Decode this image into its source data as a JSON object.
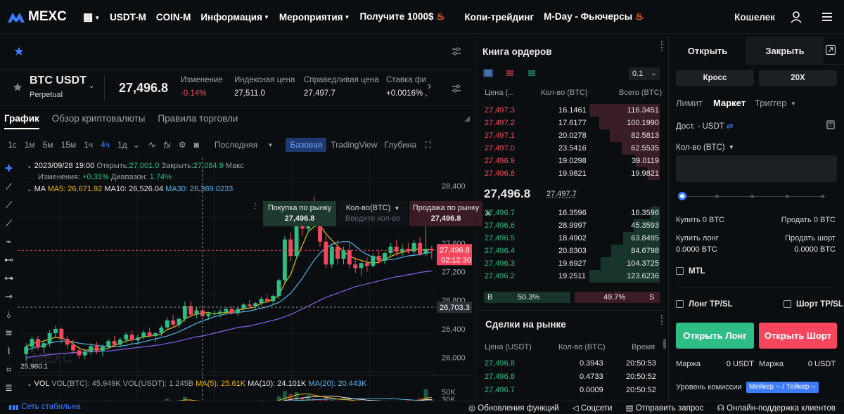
{
  "header": {
    "logo_text": "MEXC",
    "nav": [
      "USDT-M",
      "COIN-M",
      "Информация",
      "Мероприятия",
      "Получите 1000$",
      "Копи-трейдинг",
      "M-Day - Фьючерсы"
    ],
    "wallet": "Кошелек"
  },
  "ticker": {
    "symbol": "BTC USDT",
    "contract": "Perpetual",
    "last_price": "27,496.8",
    "change_label": "Изменение",
    "change_value": "-0.14%",
    "index_label": "Индексная цена",
    "index_value": "27,511.0",
    "fair_label": "Справедливая цена",
    "fair_value": "27,497.7",
    "funding_label": "Ставка фи",
    "funding_value": "+0.0016% ,"
  },
  "tabs": [
    "График",
    "Обзор криптовалюты",
    "Правила торговли"
  ],
  "timeframes": [
    "1с",
    "1м",
    "5м",
    "15м",
    "1ч",
    "4ч",
    "1д"
  ],
  "active_timeframe": "4ч",
  "price_type": "Последняя",
  "views": {
    "basic": "Базовая",
    "tradingview": "TradingView",
    "depth": "Глубина"
  },
  "ohlc": {
    "date": "2023/09/28 19:00",
    "open_label": "Открыть:",
    "open": "27,001.0",
    "close_label": "Закрыть:",
    "close": "27,084.9",
    "max_label": "Макс",
    "change_label": "Изменения:",
    "change": "+0.31%",
    "range_label": "Диапазон:",
    "range": "1.74%"
  },
  "ma": {
    "label": "MA",
    "ma5": "MA5: 26,671.92",
    "ma10": "MA10: 26,526.04",
    "ma30": "MA30: 26,389.0233"
  },
  "vol": {
    "label": "VOL",
    "btc": "VOL(BTC): 45.949K",
    "usdt": "VOL(USDT): 1.245B",
    "ma5": "MA(5): 25.61K",
    "ma10": "MA(10): 24.101K",
    "ma20": "MA(20): 20.443K"
  },
  "quick": {
    "buy_label": "Покупка по рынку",
    "buy_price": "27,496.8",
    "qty_label": "Кол-во(BTC)",
    "qty_placeholder": "Введите кол-во",
    "sell_label": "Продажа по рынку",
    "sell_price": "27,496.8"
  },
  "price_axis": [
    "28,400",
    "28,000",
    "27,600",
    "27,200",
    "26,800",
    "26,400",
    "26,000"
  ],
  "vol_axis": [
    "50K",
    "30K",
    "10K"
  ],
  "marks": {
    "current": "27,496.8",
    "countdown": "02:12:30",
    "crosshair": "26,703.3",
    "low": "25,980.1"
  },
  "chart_data": {
    "type": "candlestick",
    "candles": [
      [
        26050,
        26200,
        25950,
        26150
      ],
      [
        26150,
        26300,
        26080,
        26260
      ],
      [
        26260,
        26300,
        26100,
        26140
      ],
      [
        26140,
        26250,
        26060,
        26200
      ],
      [
        26200,
        26380,
        26150,
        26340
      ],
      [
        26340,
        26450,
        26280,
        26400
      ],
      [
        26400,
        26420,
        26200,
        26260
      ],
      [
        26260,
        26300,
        26120,
        26180
      ],
      [
        26180,
        26250,
        26050,
        26100
      ],
      [
        26100,
        26150,
        25980,
        26030
      ],
      [
        26030,
        26120,
        25980,
        26080
      ],
      [
        26080,
        26200,
        26040,
        26160
      ],
      [
        26160,
        26220,
        26050,
        26090
      ],
      [
        26090,
        26180,
        26020,
        26150
      ],
      [
        26150,
        26260,
        26120,
        26230
      ],
      [
        26230,
        26300,
        26150,
        26180
      ],
      [
        26180,
        26280,
        26140,
        26250
      ],
      [
        26250,
        26350,
        26200,
        26320
      ],
      [
        26320,
        26380,
        26200,
        26240
      ],
      [
        26240,
        26320,
        26180,
        26280
      ],
      [
        26280,
        26380,
        26250,
        26350
      ],
      [
        26350,
        26420,
        26280,
        26300
      ],
      [
        26300,
        26360,
        26220,
        26340
      ],
      [
        26340,
        26450,
        26300,
        26420
      ],
      [
        26420,
        26560,
        26380,
        26520
      ],
      [
        26520,
        26600,
        26420,
        26460
      ],
      [
        26460,
        26560,
        26420,
        26540
      ],
      [
        26540,
        26780,
        26500,
        26720
      ],
      [
        26720,
        26790,
        26560,
        26600
      ],
      [
        26600,
        26700,
        26550,
        26660
      ],
      [
        26660,
        26700,
        26540,
        26580
      ],
      [
        26580,
        26640,
        26520,
        26610
      ],
      [
        26610,
        26660,
        26560,
        26620
      ],
      [
        26620,
        26680,
        26560,
        26640
      ],
      [
        26640,
        26700,
        26600,
        26680
      ],
      [
        26680,
        26720,
        26600,
        26620
      ],
      [
        26620,
        26700,
        26580,
        26680
      ],
      [
        26680,
        26760,
        26650,
        26740
      ],
      [
        26740,
        26800,
        26680,
        26720
      ],
      [
        26720,
        26780,
        26660,
        26760
      ],
      [
        26760,
        26850,
        26720,
        26820
      ],
      [
        26820,
        26880,
        26760,
        26790
      ],
      [
        26790,
        26880,
        26750,
        26860
      ],
      [
        26860,
        27100,
        26820,
        27080
      ],
      [
        27080,
        27700,
        27050,
        27650
      ],
      [
        27650,
        27750,
        27350,
        27420
      ],
      [
        27420,
        28000,
        27380,
        27900
      ],
      [
        27900,
        28050,
        27700,
        27800
      ],
      [
        27800,
        28150,
        27750,
        28050
      ],
      [
        28050,
        28250,
        27850,
        27950
      ],
      [
        27950,
        28000,
        27550,
        27620
      ],
      [
        27620,
        27700,
        27250,
        27300
      ],
      [
        27300,
        27600,
        27250,
        27550
      ],
      [
        27550,
        27650,
        27300,
        27380
      ],
      [
        27380,
        27550,
        27300,
        27500
      ],
      [
        27500,
        27600,
        27250,
        27300
      ],
      [
        27300,
        27400,
        27180,
        27250
      ],
      [
        27250,
        27350,
        27150,
        27320
      ],
      [
        27320,
        27400,
        27200,
        27280
      ],
      [
        27280,
        27450,
        27260,
        27420
      ],
      [
        27420,
        27500,
        27300,
        27350
      ],
      [
        27350,
        27480,
        27300,
        27460
      ],
      [
        27460,
        27600,
        27400,
        27550
      ],
      [
        27550,
        27650,
        27420,
        27480
      ],
      [
        27480,
        27580,
        27420,
        27520
      ],
      [
        27520,
        27600,
        27450,
        27480
      ],
      [
        27480,
        27640,
        27440,
        27600
      ],
      [
        27600,
        27680,
        27420,
        27450
      ],
      [
        27450,
        27950,
        27420,
        27520
      ],
      [
        27520,
        27560,
        27380,
        27497
      ]
    ],
    "ma5": [
      26150,
      26200,
      26210,
      26230,
      26260,
      26280,
      26270,
      26250,
      26190,
      26130,
      26100,
      26110,
      26120,
      26110,
      26130,
      26170,
      26200,
      26230,
      26250,
      26260,
      26290,
      26300,
      26310,
      26330,
      26390,
      26420,
      26460,
      26540,
      26580,
      26610,
      26620,
      26630,
      26610,
      26620,
      26630,
      26640,
      26660,
      26680,
      26690,
      26710,
      26760,
      26780,
      26810,
      26870,
      27040,
      27160,
      27390,
      27570,
      27760,
      27830,
      27850,
      27730,
      27640,
      27560,
      27480,
      27420,
      27380,
      27360,
      27330,
      27320,
      27330,
      27370,
      27410,
      27450,
      27470,
      27500,
      27520,
      27510,
      27510,
      27510
    ],
    "ma10": [
      26100,
      26130,
      26150,
      26170,
      26200,
      26220,
      26230,
      26230,
      26220,
      26200,
      26190,
      26180,
      26170,
      26160,
      26150,
      26150,
      26160,
      26170,
      26190,
      26200,
      26220,
      26240,
      26260,
      26280,
      26300,
      26330,
      26360,
      26400,
      26440,
      26480,
      26510,
      26540,
      26570,
      26590,
      26610,
      26620,
      26630,
      26640,
      26650,
      26670,
      26690,
      26710,
      26740,
      26770,
      26830,
      26900,
      27000,
      27110,
      27240,
      27360,
      27460,
      27530,
      27580,
      27610,
      27620,
      27620,
      27560,
      27490,
      27440,
      27400,
      27380,
      27370,
      27370,
      27380,
      27400,
      27420,
      27430,
      27440,
      27460,
      27470
    ],
    "ma30": [
      26000,
      26010,
      26020,
      26030,
      26040,
      26050,
      26060,
      26060,
      26070,
      26070,
      26080,
      26080,
      26080,
      26090,
      26090,
      26100,
      26110,
      26120,
      26130,
      26140,
      26150,
      26160,
      26170,
      26180,
      26200,
      26210,
      26230,
      26250,
      26270,
      26290,
      26300,
      26320,
      26340,
      26360,
      26380,
      26400,
      26420,
      26430,
      26440,
      26460,
      26480,
      26500,
      26520,
      26540,
      26570,
      26600,
      26640,
      26680,
      26720,
      26760,
      26800,
      26840,
      26870,
      26900,
      26930,
      26960,
      26990,
      27010,
      27030,
      27050,
      27070,
      27090,
      27110,
      27130,
      27140,
      27160,
      27170,
      27190,
      27200,
      27210
    ],
    "volumes": [
      18,
      22,
      16,
      20,
      24,
      26,
      19,
      17,
      21,
      25,
      15,
      18,
      20,
      23,
      27,
      19,
      22,
      24,
      18,
      21,
      26,
      23,
      19,
      25,
      31,
      22,
      28,
      36,
      24,
      20,
      18,
      22,
      19,
      26,
      21,
      18,
      24,
      20,
      17,
      23,
      27,
      22,
      25,
      38,
      52,
      44,
      49,
      36,
      41,
      33,
      30,
      35,
      28,
      27,
      24,
      29,
      22,
      26,
      21,
      25,
      23,
      27,
      26,
      24,
      22,
      28,
      25,
      33,
      57,
      30
    ],
    "price_ylim": [
      25800,
      28600
    ]
  },
  "orderbook": {
    "title": "Книга ордеров",
    "precision": "0.1",
    "col_price": "Цена (...",
    "col_qty": "Кол-во (BTC)",
    "col_total": "Всего (BTC)",
    "asks": [
      [
        "27,497.3",
        "16.1461",
        "116.3451"
      ],
      [
        "27,497.2",
        "17.6177",
        "100.1990"
      ],
      [
        "27,497.1",
        "20.0278",
        "82.5813"
      ],
      [
        "27,497.0",
        "23.5416",
        "62.5535"
      ],
      [
        "27,496.9",
        "19.0298",
        "39.0119"
      ],
      [
        "27,496.8",
        "19.9821",
        "19.9821"
      ]
    ],
    "ask_depth": [
      1.0,
      0.86,
      0.71,
      0.54,
      0.34,
      0.17
    ],
    "mid_price": "27,496.8",
    "mid_mark": "27,497.7",
    "bids": [
      [
        "27,496.7",
        "16.3596",
        "16.3596"
      ],
      [
        "27,496.6",
        "28.9997",
        "45.3593"
      ],
      [
        "27,496.5",
        "18.4902",
        "63.8495"
      ],
      [
        "27,496.4",
        "20.8303",
        "84.6798"
      ],
      [
        "27,496.3",
        "19.6927",
        "104.3725"
      ],
      [
        "27,496.2",
        "19.2511",
        "123.6236"
      ]
    ],
    "bid_depth": [
      0.13,
      0.37,
      0.52,
      0.69,
      0.84,
      1.0
    ],
    "buy_label": "B",
    "buy_pct": "50.3%",
    "sell_pct": "49.7%",
    "sell_label": "S",
    "buy_ratio": 0.503
  },
  "trades": {
    "title": "Сделки на рынке",
    "col_price": "Цена (USDT)",
    "col_qty": "Кол-во (BTC)",
    "col_time": "Время",
    "rows": [
      [
        "27,496.8",
        "0.3943",
        "20:50:53"
      ],
      [
        "27,496.8",
        "0.4733",
        "20:50:52"
      ],
      [
        "27,496.7",
        "0.0009",
        "20:50:52"
      ]
    ]
  },
  "order": {
    "tab_open": "Открыть",
    "tab_close": "Закрыть",
    "margin_mode": "Кросс",
    "leverage": "20X",
    "types": [
      "Лимит",
      "Маркет",
      "Триггер"
    ],
    "active_type": "Маркет",
    "available_label": "Дост. - USDT",
    "qty_label": "Кол-во (BTC)",
    "buy_label": "Купить 0 BTC",
    "sell_label": "Продать 0 BTC",
    "buy_long_label": "Купить лонг",
    "sell_short_label": "Продать шорт",
    "buy_long_value": "0.0000 BTC",
    "sell_short_value": "0.0000 BTC",
    "mtl": "MTL",
    "long_tpsl": "Лонг TP/SL",
    "short_tpsl": "Шорт TP/SL",
    "open_long": "Открыть Лонг",
    "open_short": "Открыть Шорт",
    "margin_label": "Маржа",
    "margin_long": "0 USDT",
    "margin_short": "0 USDT",
    "fee_label": "Уровень комиссии",
    "fee_badge": "Мейкер -- / Тейкер --"
  },
  "footer": {
    "network": "Сеть стабильна",
    "links": [
      "Обновления функций",
      "Соцсети",
      "Отправить запрос",
      "Онлайн-поддержка клиентов"
    ]
  },
  "colors": {
    "up": "#2ebd85",
    "down": "#f6465d",
    "accent": "#3d7bff",
    "ma5": "#f0b90b",
    "ma10": "#e2e2e2",
    "ma30": "#59b3e6"
  }
}
